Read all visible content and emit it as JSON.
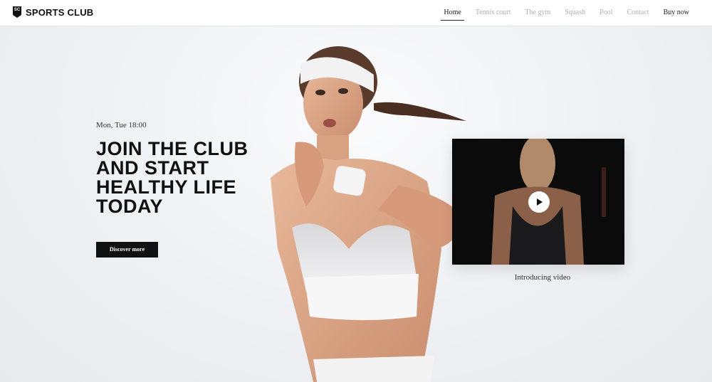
{
  "header": {
    "logo_mark": "SC",
    "logo_text": "SPORTS CLUB",
    "nav": [
      {
        "label": "Home",
        "active": true
      },
      {
        "label": "Tennis court",
        "active": false
      },
      {
        "label": "The gym",
        "active": false
      },
      {
        "label": "Squash",
        "active": false
      },
      {
        "label": "Pool",
        "active": false
      },
      {
        "label": "Contact",
        "active": false
      },
      {
        "label": "Buy now",
        "active": false
      }
    ]
  },
  "hero": {
    "schedule": "Mon, Tue 18:00",
    "headline_lines": [
      "JOIN THE CLUB",
      "AND START",
      "HEALTHY LIFE",
      "TODAY"
    ],
    "cta_label": "Discover more"
  },
  "video": {
    "caption": "Introducing video",
    "play_icon": "play-icon"
  },
  "colors": {
    "accent": "#111111",
    "nav_inactive": "#b0b0b0",
    "background": "#f3f4f6"
  }
}
